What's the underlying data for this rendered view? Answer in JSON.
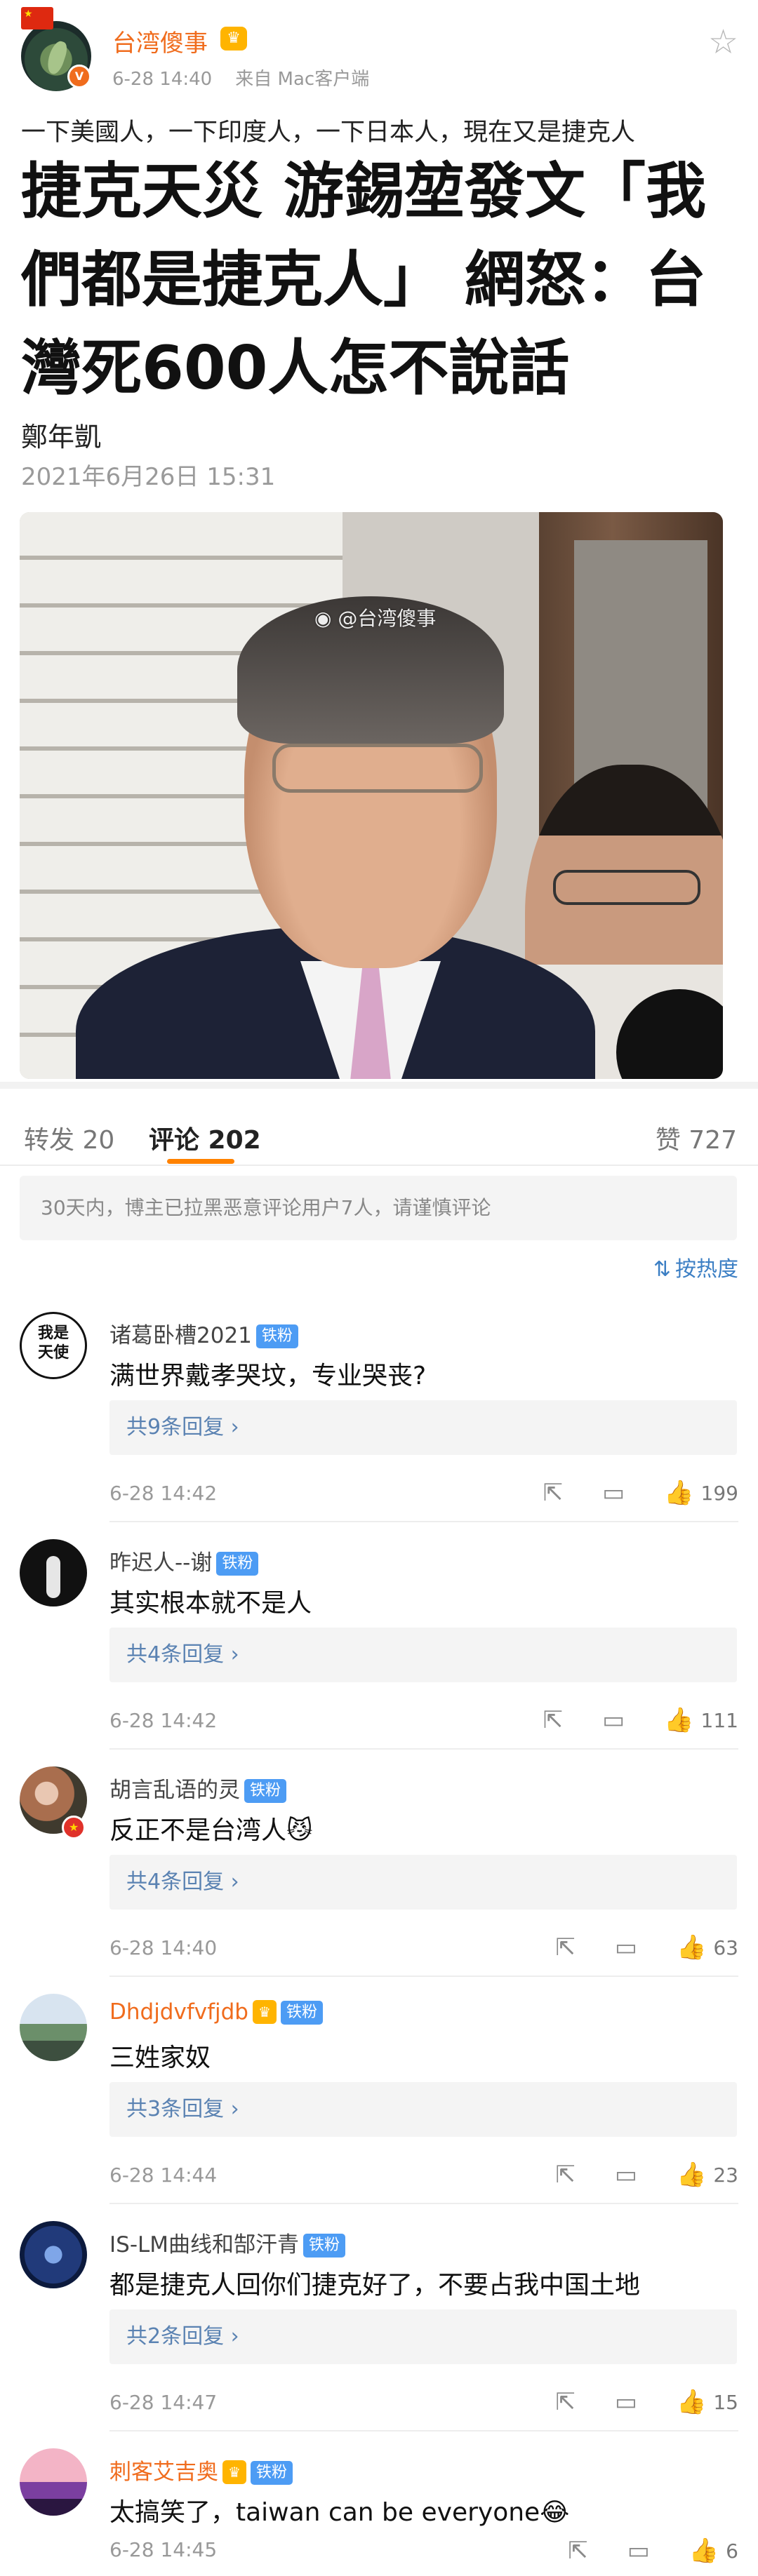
{
  "post": {
    "user_name": "台湾傻事",
    "time": "6-28 14:40",
    "source": "来自 Mac客户端",
    "verified_mark": "V"
  },
  "article": {
    "kicker": "一下美國人，一下印度人，一下日本人，現在又是捷克人",
    "headline": "捷克天災 游錫堃發文「我們都是捷克人」 網怒：台灣死600人怎不說話",
    "author": "鄭年凱",
    "date": "2021年6月26日 15:31",
    "photo_watermark": "@台湾傻事"
  },
  "tabs": {
    "repost": "转发 20",
    "comments": "评论 202",
    "likes": "赞 727"
  },
  "notice": "30天内，博主已拉黑恶意评论用户7人，请谨慎评论",
  "sort_label": "按热度",
  "fan_badge_label": "铁粉",
  "comments": [
    {
      "name": "诸葛卧槽2021",
      "text": "满世界戴孝哭坟，专业哭丧?",
      "replies": "共9条回复 ›",
      "time": "6-28 14:42",
      "likes": "199",
      "avatar_text": "我是\n天使"
    },
    {
      "name": "昨迟人--谢",
      "text": "其实根本就不是人",
      "replies": "共4条回复 ›",
      "time": "6-28 14:42",
      "likes": "111"
    },
    {
      "name": "胡言乱语的灵",
      "text": "反正不是台湾人😼",
      "replies": "共4条回复 ›",
      "time": "6-28 14:40",
      "likes": "63"
    },
    {
      "name": "Dhdjdvfvfjdb",
      "text": "三姓家奴",
      "replies": "共3条回复 ›",
      "time": "6-28 14:44",
      "likes": "23"
    },
    {
      "name": "IS-LM曲线和郜汗青",
      "text": "都是捷克人回你们捷克好了，不要占我中国土地",
      "replies": "共2条回复 ›",
      "time": "6-28 14:47",
      "likes": "15"
    },
    {
      "name": "刺客艾吉奥",
      "text": "太搞笑了，taiwan can be everyone😂",
      "time": "6-28 14:45",
      "likes": "6"
    }
  ],
  "icons": {
    "favorite": "star-icon",
    "share": "share-icon",
    "comment": "comment-icon",
    "like": "thumbs-up-icon",
    "sort": "sort-icon"
  },
  "colors": {
    "accent": "#ff8200",
    "username_orange": "#f06c1d",
    "link_blue": "#5a82b2",
    "fan_badge": "#4d9cf4"
  }
}
